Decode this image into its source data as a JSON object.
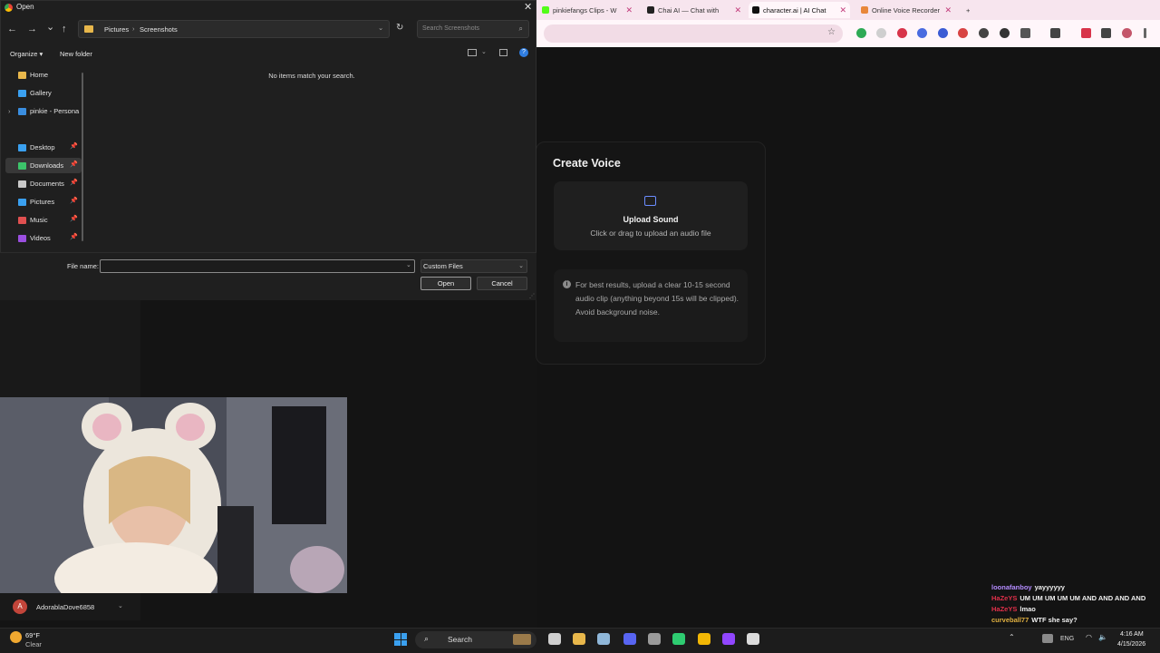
{
  "browser": {
    "tabs": [
      {
        "label": "pinkiefangs Clips - W",
        "color": "#53fc18"
      },
      {
        "label": "Chai AI — Chat with",
        "color": "#222222"
      },
      {
        "label": "character.ai | AI Chat",
        "color": "#111111",
        "active": true
      },
      {
        "label": "Online Voice Recorder",
        "color": "#e8873a"
      }
    ],
    "new_tab": "+"
  },
  "dialog": {
    "title": "Open",
    "close": "✕",
    "nav": {
      "back": "←",
      "forward": "→",
      "recent": "⌄",
      "up": "↑"
    },
    "path": [
      "Pictures",
      "Screenshots"
    ],
    "path_sep": "›",
    "path_dropdown": "⌄",
    "refresh": "↻",
    "search_placeholder": "Search Screenshots",
    "search_icon": "⌕",
    "organize": "Organize ▾",
    "new_folder": "New folder",
    "help": "?",
    "empty_message": "No items match your search.",
    "nav_items": [
      {
        "label": "Home",
        "icon": "home-icon",
        "color": "#e8b74b",
        "pinned": false,
        "expand": false
      },
      {
        "label": "Gallery",
        "icon": "gallery-icon",
        "color": "#3aa0f0",
        "pinned": false,
        "expand": false
      },
      {
        "label": "pinkie - Persona",
        "icon": "onedrive-icon",
        "color": "#3a8ee0",
        "pinned": false,
        "expand": true
      },
      {
        "label": "Desktop",
        "icon": "desktop-icon",
        "color": "#3aa0f0",
        "pinned": true,
        "expand": false
      },
      {
        "label": "Downloads",
        "icon": "download-icon",
        "color": "#3cc46a",
        "pinned": true,
        "expand": false,
        "selected": true
      },
      {
        "label": "Documents",
        "icon": "document-icon",
        "color": "#c9c9c9",
        "pinned": true,
        "expand": false
      },
      {
        "label": "Pictures",
        "icon": "pictures-icon",
        "color": "#3aa0f0",
        "pinned": true,
        "expand": false
      },
      {
        "label": "Music",
        "icon": "music-icon",
        "color": "#e05050",
        "pinned": true,
        "expand": false
      },
      {
        "label": "Videos",
        "icon": "videos-icon",
        "color": "#9b4fe0",
        "pinned": true,
        "expand": false
      }
    ],
    "pin_glyph": "📌",
    "expand_glyph": "›",
    "file_name_label": "File name:",
    "file_name_value": "",
    "file_type": "Custom Files",
    "dropdown": "⌄",
    "open_button": "Open",
    "cancel_button": "Cancel"
  },
  "create_voice": {
    "title": "Create Voice",
    "upload_title": "Upload Sound",
    "upload_subtitle": "Click or drag to upload an audio file",
    "tip_icon": "i",
    "tip": "For best results, upload a clear 10-15 second audio clip (anything beyond 15s will be clipped). Avoid background noise."
  },
  "stream": {
    "user_avatar": "A",
    "username": "AdorablaDove6858",
    "chevron": "⌄"
  },
  "chat": [
    {
      "user": "loonafanboy",
      "color": "#b48cff",
      "text": "yayyyyyy"
    },
    {
      "user": "HaZeYS",
      "color": "#e0304a",
      "text": "UM UM UM UM UM AND AND AND AND"
    },
    {
      "user": "HaZeYS",
      "color": "#e0304a",
      "text": "lmao"
    },
    {
      "user": "curveball77",
      "color": "#e0b040",
      "text": "WTF she say?"
    }
  ],
  "taskbar": {
    "temperature": "69°F",
    "condition": "Clear",
    "search_label": "Search",
    "search_icon": "⌕",
    "language": "ENG",
    "time": "4:16 AM",
    "date": "4/15/2026",
    "apps": [
      {
        "name": "task-view-icon",
        "color": "#cfcfcf"
      },
      {
        "name": "file-explorer-icon",
        "color": "#e8b74b"
      },
      {
        "name": "steam-icon",
        "color": "#8fb7d9"
      },
      {
        "name": "discord-icon",
        "color": "#5865f2"
      },
      {
        "name": "obs-icon",
        "color": "#9a9a9a"
      },
      {
        "name": "app-green-icon",
        "color": "#2ecc71"
      },
      {
        "name": "chrome-icon",
        "color": "#f2b705"
      },
      {
        "name": "kick-icon",
        "color": "#9146ff"
      },
      {
        "name": "notepad-icon",
        "color": "#dcdcdc"
      }
    ]
  }
}
